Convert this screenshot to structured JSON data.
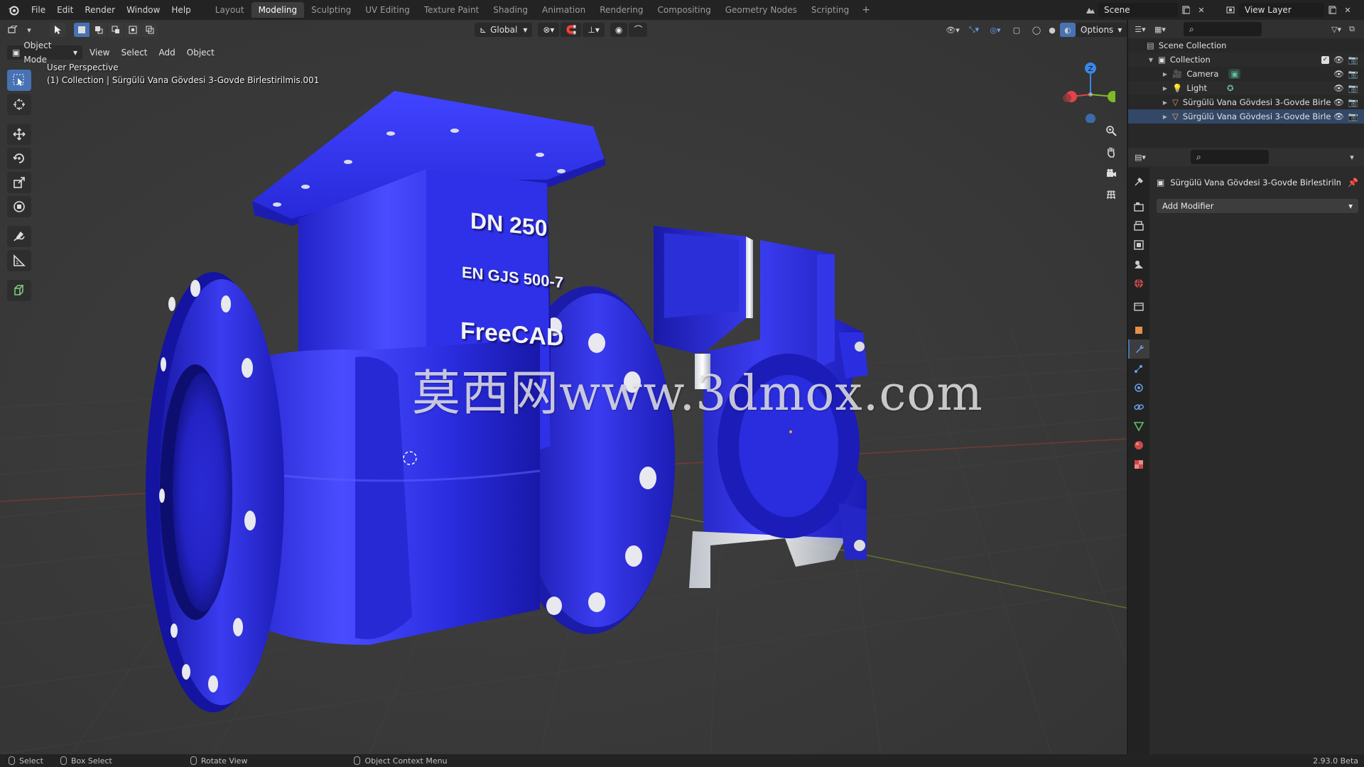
{
  "topbar": {
    "menus": [
      "File",
      "Edit",
      "Render",
      "Window",
      "Help"
    ],
    "workspaces": [
      "Layout",
      "Modeling",
      "Sculpting",
      "UV Editing",
      "Texture Paint",
      "Shading",
      "Animation",
      "Rendering",
      "Compositing",
      "Geometry Nodes",
      "Scripting"
    ],
    "active_workspace": "Modeling",
    "add_tab": "+",
    "scene_name": "Scene",
    "view_layer": "View Layer"
  },
  "viewport": {
    "mode": "Object Mode",
    "menus": [
      "View",
      "Select",
      "Add",
      "Object"
    ],
    "transform_orientation": "Global",
    "options": "Options",
    "perspective": "User Perspective",
    "context": "(1) Collection | Sürgülü Vana Gövdesi 3-Govde Birlestirilmis.001",
    "axis_labels": {
      "z": "Z"
    },
    "model_text": [
      "DN 250",
      "EN GJS 500-7",
      "FreeCAD"
    ],
    "watermark": "莫西网www.3dmox.com"
  },
  "outliner": {
    "items": [
      {
        "label": "Scene Collection",
        "icon": "scene-collection-icon",
        "indent": 0
      },
      {
        "label": "Collection",
        "icon": "collection-icon",
        "indent": 1
      },
      {
        "label": "Camera",
        "icon": "camera-icon",
        "indent": 2
      },
      {
        "label": "Light",
        "icon": "light-icon",
        "indent": 2
      },
      {
        "label": "Sürgülü Vana Gövdesi 3-Govde Birle",
        "icon": "mesh-icon",
        "indent": 2
      },
      {
        "label": "Sürgülü Vana Gövdesi 3-Govde Birle",
        "icon": "mesh-icon",
        "indent": 2
      }
    ]
  },
  "properties": {
    "object_name": "Sürgülü Vana Gövdesi 3-Govde Birlestirilmis...",
    "add_modifier": "Add Modifier"
  },
  "statusbar": {
    "select": "Select",
    "box_select": "Box Select",
    "rotate_view": "Rotate View",
    "context_menu": "Object Context Menu",
    "version": "2.93.0 Beta"
  },
  "colors": {
    "accent": "#4772b3",
    "model_blue": "#2a2ee0",
    "axis_x": "#e0454a",
    "axis_y": "#7cbb25",
    "axis_z": "#3a86e8"
  }
}
